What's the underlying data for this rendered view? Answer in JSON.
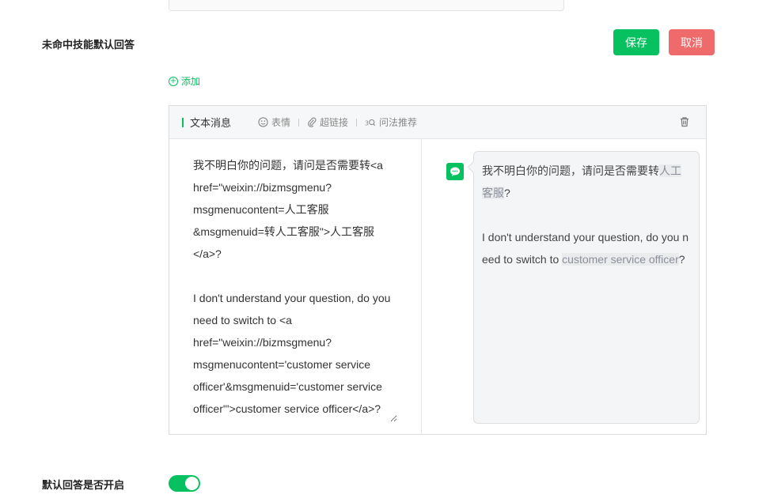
{
  "section": {
    "title": "未命中技能默认回答",
    "save_label": "保存",
    "cancel_label": "取消",
    "add_label": "添加"
  },
  "message_editor": {
    "type_label": "文本消息",
    "toolbar": {
      "emoji_label": "表情",
      "hyperlink_label": "超链接",
      "question_label": "问法推荐"
    },
    "content": "我不明白你的问题，请问是否需要转<a href=\"weixin://bizmsgmenu?msgmenucontent=人工客服&msgmenuid=转人工客服\">人工客服</a>?\n\nI don't understand your question, do you need to switch to <a href=\"weixin://bizmsgmenu?msgmenucontent='customer service officer'&msgmenuid='customer service officer'\">customer service officer</a>?"
  },
  "preview": {
    "zh_text": "我不明白你的问题，请问是否需要转",
    "zh_link": "人工客服",
    "zh_end": "?",
    "en_text": "I don't understand your question, do you need to switch to ",
    "en_link": "customer service officer",
    "en_end": "?"
  },
  "default_answer": {
    "label": "默认回答是否开启",
    "enabled": true
  },
  "colors": {
    "accent": "#07c160",
    "danger": "#ef6b6b"
  }
}
